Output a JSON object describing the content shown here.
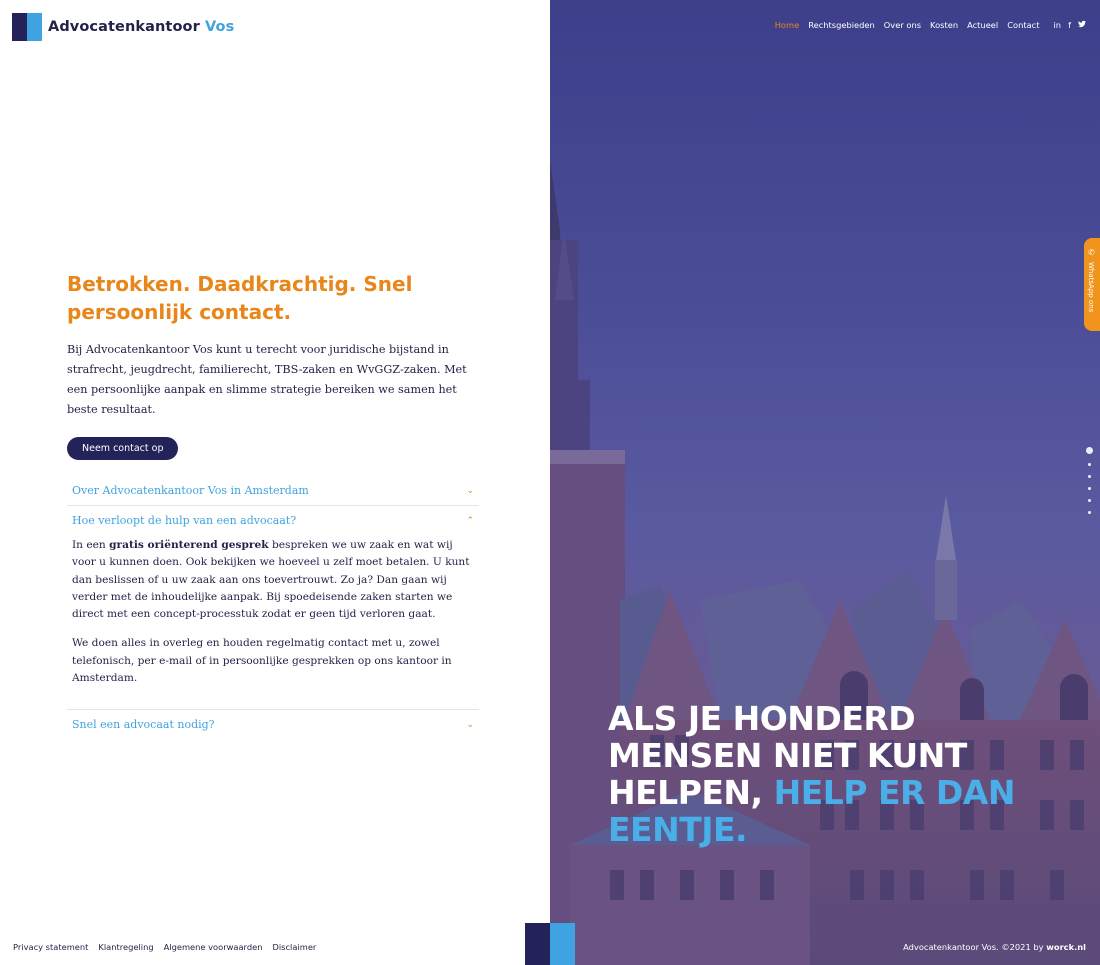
{
  "brand": {
    "name_main": "Advocatenkantoor",
    "name_accent": "Vos"
  },
  "nav": {
    "items": [
      "Home",
      "Rechtsgebieden",
      "Over ons",
      "Kosten",
      "Actueel",
      "Contact"
    ],
    "active": "Home",
    "social": [
      "in",
      "f",
      "t"
    ]
  },
  "hero": {
    "headline": "Betrokken. Daadkrachtig. Snel persoonlijk contact.",
    "intro": "Bij Advocatenkantoor Vos kunt u terecht voor juridische bijstand in strafrecht, jeugdrecht, familierecht, TBS-zaken en WvGGZ-zaken. Met een persoonlijke aanpak en slimme strategie bereiken we samen het beste resultaat.",
    "cta": "Neem contact op"
  },
  "accordion": [
    {
      "title": "Over Advocatenkantoor Vos in Amsterdam",
      "open": false
    },
    {
      "title": "Hoe verloopt de hulp van een advocaat?",
      "open": true,
      "p1_pre": "In een ",
      "p1_bold": "gratis oriënterend gesprek",
      "p1_post": " bespreken we uw zaak en wat wij voor u kunnen doen. Ook bekijken we hoeveel u zelf moet betalen. U kunt dan beslissen of u uw zaak aan ons toevertrouwt. Zo ja? Dan gaan wij verder met de inhoudelijke aanpak. Bij spoedeisende zaken starten we direct met een concept-processtuk zodat er geen tijd verloren gaat.",
      "p2": "We doen alles in overleg en houden regelmatig contact met u, zowel telefonisch, per e-mail of in persoonlijke gesprekken op ons kantoor in Amsterdam."
    },
    {
      "title": "Snel een advocaat nodig?",
      "open": false
    }
  ],
  "quote": {
    "white": "ALS JE HONDERD MENSEN NIET KUNT HELPEN,",
    "blue": "HELP ER DAN EENTJE."
  },
  "whatsapp": {
    "label": "WhatsApp ons"
  },
  "footer": {
    "links": [
      "Privacy statement",
      "Klantregeling",
      "Algemene voorwaarden",
      "Disclaimer"
    ],
    "credit_text": "Advocatenkantoor Vos. ©2021 by",
    "credit_brand": "worck.nl"
  },
  "colors": {
    "navy": "#23235a",
    "accent_blue": "#3ea3e0",
    "orange": "#e8861a"
  }
}
